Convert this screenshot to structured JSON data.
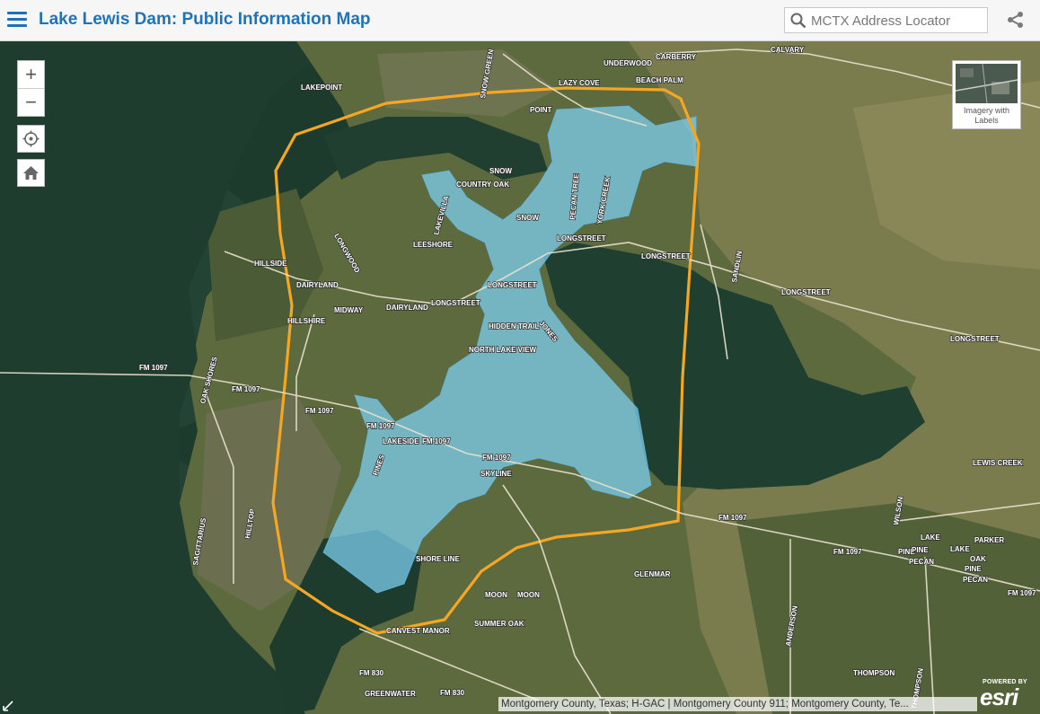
{
  "header": {
    "title": "Lake Lewis Dam: Public Information Map",
    "search_placeholder": "MCTX Address Locator"
  },
  "map": {
    "zoom_in": "+",
    "zoom_out": "−",
    "basemap_label": "Imagery with Labels",
    "attribution": "Montgomery County, Texas; H-GAC | Montgomery County 911; Montgomery County, Te...",
    "esri_powered": "POWERED BY",
    "esri_brand": "esri",
    "inundation_color": "#7ed3f5",
    "boundary_color": "#f5a623",
    "road_labels": [
      "CALVARY",
      "UNDERWOOD",
      "CARBERRY",
      "LAZY COVE",
      "BEACH PALM",
      "LAKEPOINT",
      "SNOW GREEN",
      "POINT",
      "SNOW",
      "COUNTRY OAK",
      "PECAN TREE",
      "YORK CREEK",
      "LAKEVILLA",
      "LEESHORE",
      "LONGWOOD",
      "HILLSIDE",
      "DAIRYLAND",
      "MIDWAY",
      "LONGSTREET",
      "HIDDEN TRAIL",
      "JONES",
      "NORTH LAKE VIEW",
      "HILLSHIRE",
      "FM 1097",
      "LAKESIDE",
      "SKYLINE",
      "SHORELINE",
      "LAKEVIEW",
      "GLENNMAR",
      "SUMMER OAK",
      "CANVEST MANOR",
      "FM 830",
      "GREENWATER",
      "LEWIS CREEK",
      "PARKER",
      "LAKE",
      "PINE",
      "PECAN",
      "OAK",
      "THOMPSON",
      "ANDERSON",
      "SANDLIN",
      "WILSON",
      "MOON",
      "OAK SHORES",
      "SAGITTARIUS",
      "GREEN",
      "LAKEHIL",
      "HILLTOP",
      "PINES"
    ]
  }
}
